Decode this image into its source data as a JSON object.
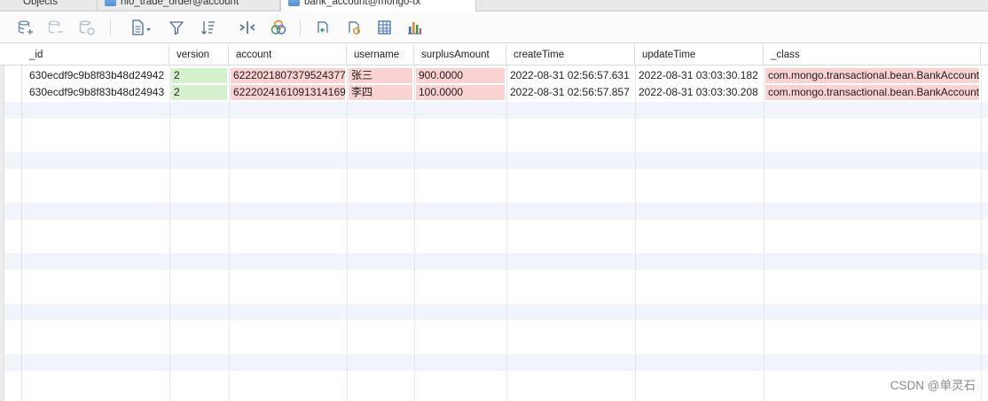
{
  "tabs": [
    {
      "label": "Objects"
    },
    {
      "label": "nio_trade_order@account"
    },
    {
      "label": "bank_account@mongo-tx"
    }
  ],
  "toolbar": {
    "buttons": [
      {
        "name": "add-record-button",
        "icon": "database-plus-icon"
      },
      {
        "name": "delete-record-button",
        "icon": "database-minus-icon"
      },
      {
        "name": "refresh-button",
        "icon": "refresh-icon"
      },
      {
        "name": "export-button",
        "icon": "document-dropdown-icon"
      },
      {
        "name": "filter-button",
        "icon": "funnel-icon"
      },
      {
        "name": "sort-button",
        "icon": "sort-icon"
      },
      {
        "name": "column-width-button",
        "icon": "collapse-columns-icon"
      },
      {
        "name": "color-button",
        "icon": "circles-icon"
      },
      {
        "name": "undo-button",
        "icon": "undo-icon"
      },
      {
        "name": "revert-button",
        "icon": "revert-icon"
      },
      {
        "name": "grid-view-button",
        "icon": "grid-view-icon"
      },
      {
        "name": "chart-button",
        "icon": "bar-chart-icon"
      }
    ]
  },
  "table": {
    "columns": [
      "_id",
      "version",
      "account",
      "username",
      "surplusAmount",
      "createTime",
      "updateTime",
      "_class"
    ],
    "rows": [
      [
        "630ecdf9c9b8f83b48d24942",
        "2",
        "6222021807379524377",
        "张三",
        "900.0000",
        "2022-08-31 02:56:57.631",
        "2022-08-31 03:03:30.182",
        "com.mongo.transactional.bean.BankAccount"
      ],
      [
        "630ecdf9c9b8f83b48d24943",
        "2",
        "6222024161091314169",
        "李四",
        "100.0000",
        "2022-08-31 02:56:57.857",
        "2022-08-31 03:03:30.208",
        "com.mongo.transactional.bean.BankAccount"
      ]
    ],
    "cell_colors": {
      "version": "#d4f0cd",
      "changed": "#f9d2d1"
    }
  },
  "watermark": "CSDN @单灵石"
}
